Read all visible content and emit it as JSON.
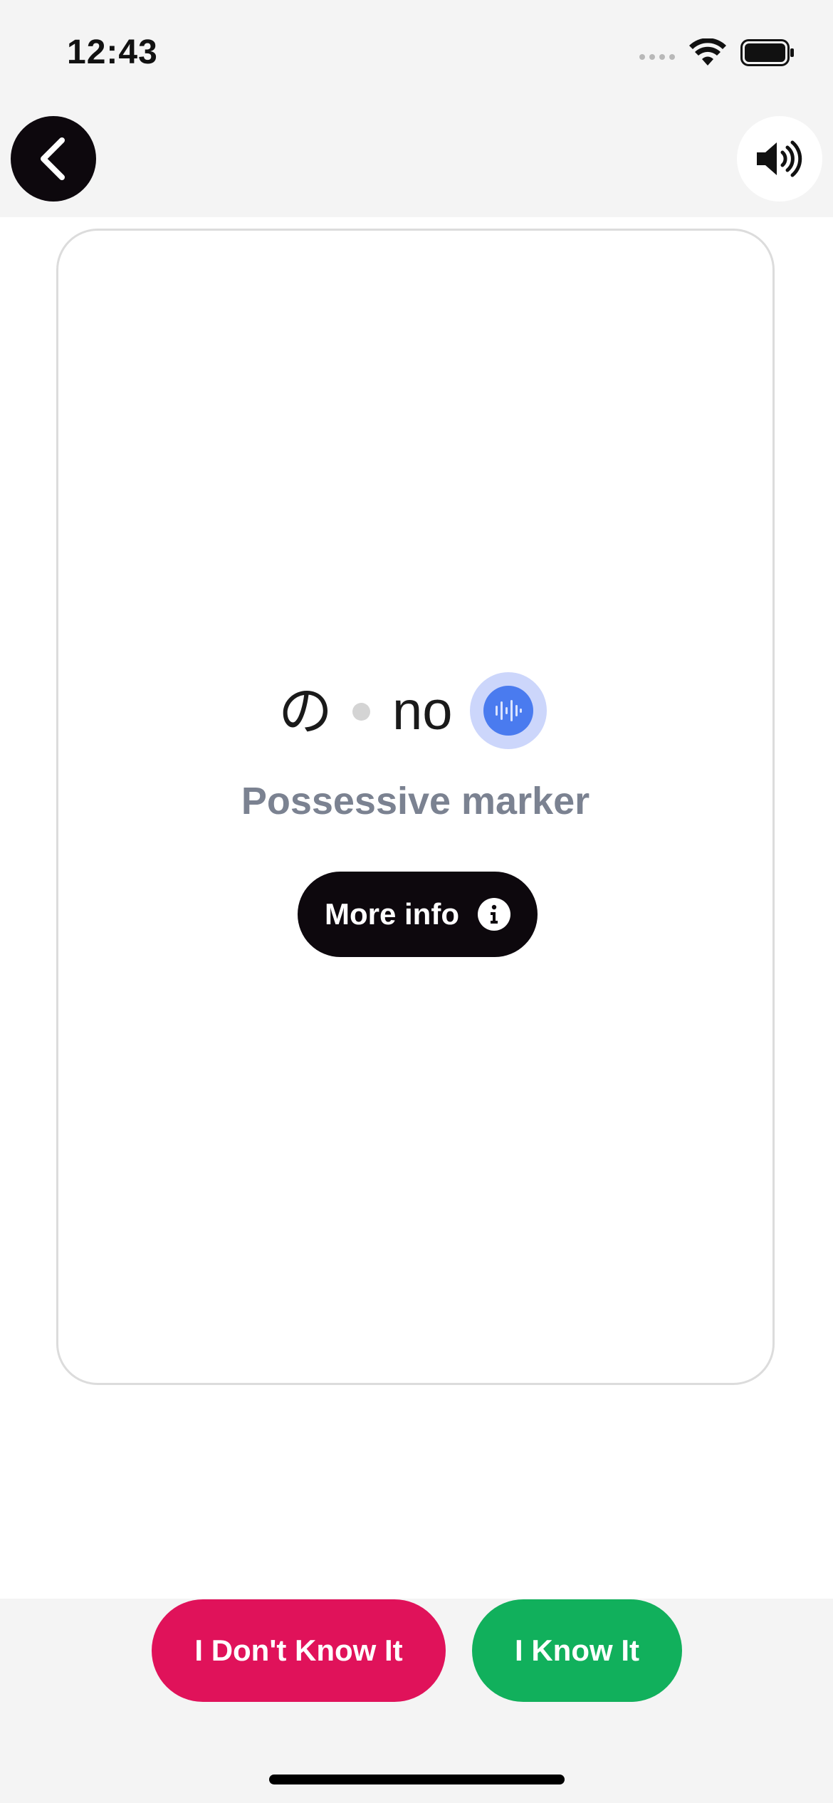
{
  "status_bar": {
    "time": "12:43"
  },
  "header": {
    "back_icon": "chevron-left-icon",
    "sound_icon": "speaker-volume-icon"
  },
  "card": {
    "kana": "の",
    "romaji": "no",
    "meaning": "Possessive marker",
    "audio_icon": "audio-waveform-icon",
    "more_info_label": "More info",
    "info_icon": "info-icon"
  },
  "actions": {
    "dont_know_label": "I Don't Know It",
    "know_label": "I Know It"
  },
  "colors": {
    "dont_know": "#e0125a",
    "know": "#11b05c",
    "dark_button": "#0d080d",
    "audio_accent": "#4a7bef",
    "meaning_text": "#7b8291"
  }
}
